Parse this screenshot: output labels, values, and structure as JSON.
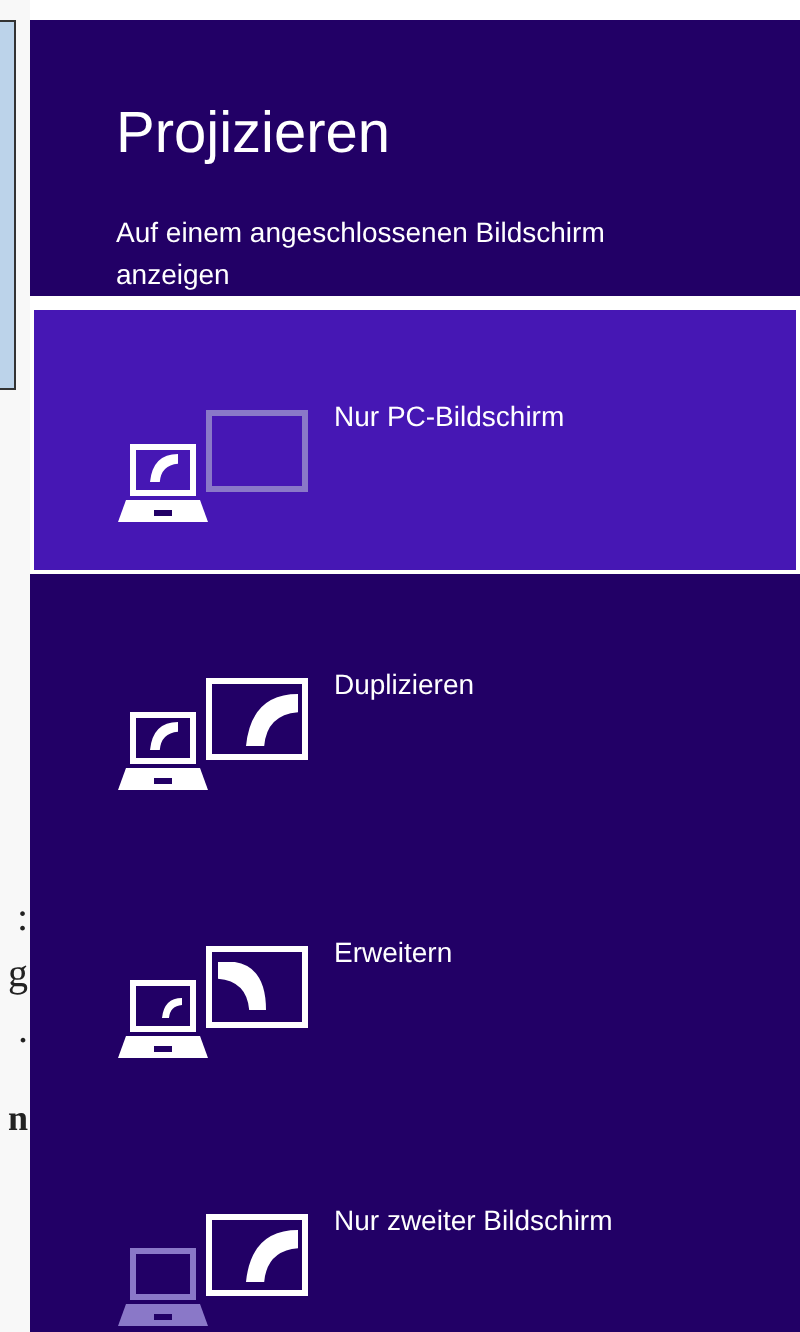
{
  "background_document": {
    "fragments": [
      {
        "text": ":",
        "bold": false
      },
      {
        "text": "g",
        "bold": false
      },
      {
        "text": ".",
        "bold": false
      },
      {
        "text": "n",
        "bold": true
      }
    ]
  },
  "panel": {
    "title": "Projizieren",
    "subtitle": "Auf einem angeschlossenen Bildschirm anzeigen"
  },
  "options": [
    {
      "kind": "pc-only",
      "label": "Nur PC-Bildschirm",
      "selected": true
    },
    {
      "kind": "duplicate",
      "label": "Duplizieren",
      "selected": false
    },
    {
      "kind": "extend",
      "label": "Erweitern",
      "selected": false
    },
    {
      "kind": "second-only",
      "label": "Nur zweiter Bildschirm",
      "selected": false
    }
  ]
}
